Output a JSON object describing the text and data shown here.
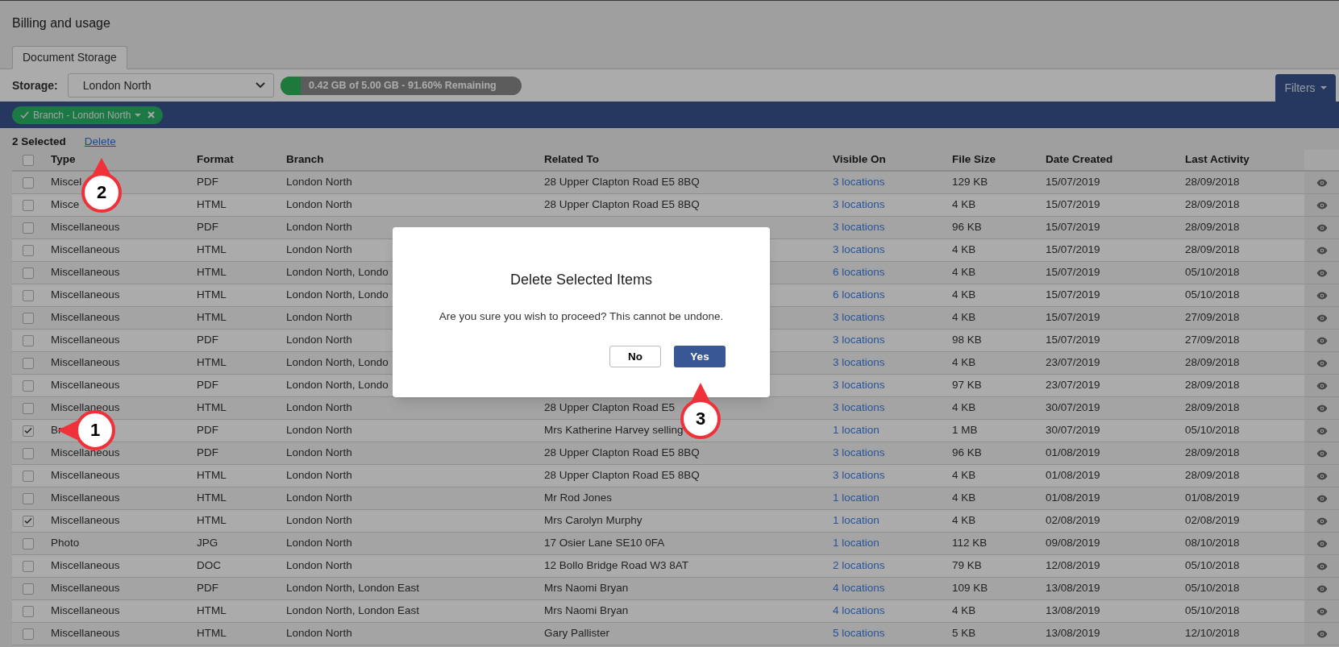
{
  "page": {
    "title": "Billing and usage"
  },
  "tabs": [
    {
      "label": "Document Storage",
      "selected": true
    }
  ],
  "storage": {
    "label": "Storage:",
    "value": "London North",
    "usage": {
      "level": 0.084,
      "text": "0.42 GB of 5.00 GB - 91.60% Remaining"
    }
  },
  "filters_button": {
    "label": "Filters"
  },
  "filter_chips": [
    {
      "label": "Branch - London North"
    }
  ],
  "selection": {
    "count": "2 Selected",
    "action": "Delete"
  },
  "table": {
    "select_all_checked": false,
    "columns": [
      "Type",
      "Format",
      "Branch",
      "Related To",
      "Visible On",
      "File Size",
      "Date Created",
      "Last Activity"
    ],
    "rows": [
      {
        "checked": false,
        "type": "Miscel",
        "format": "PDF",
        "branch": "London North",
        "related_to": "28 Upper Clapton Road E5 8BQ",
        "visible_on": "3 locations",
        "file_size": "129 KB",
        "date_created": "15/07/2019",
        "last_activity": "28/09/2018"
      },
      {
        "checked": false,
        "type": "Misce",
        "format": "HTML",
        "branch": "London North",
        "related_to": "28 Upper Clapton Road E5 8BQ",
        "visible_on": "3 locations",
        "file_size": "4 KB",
        "date_created": "15/07/2019",
        "last_activity": "28/09/2018"
      },
      {
        "checked": false,
        "type": "Miscellaneous",
        "format": "PDF",
        "branch": "London North",
        "visible_on": "3 locations",
        "file_size": "96 KB",
        "date_created": "15/07/2019",
        "last_activity": "28/09/2018"
      },
      {
        "checked": false,
        "type": "Miscellaneous",
        "format": "HTML",
        "branch": "London North",
        "visible_on": "3 locations",
        "file_size": "4 KB",
        "date_created": "15/07/2019",
        "last_activity": "28/09/2018"
      },
      {
        "checked": false,
        "type": "Miscellaneous",
        "format": "HTML",
        "branch": "London North, Londo",
        "visible_on": "6 locations",
        "file_size": "4 KB",
        "date_created": "15/07/2019",
        "last_activity": "05/10/2018"
      },
      {
        "checked": false,
        "type": "Miscellaneous",
        "format": "HTML",
        "branch": "London North, Londo",
        "visible_on": "6 locations",
        "file_size": "4 KB",
        "date_created": "15/07/2019",
        "last_activity": "05/10/2018"
      },
      {
        "checked": false,
        "type": "Miscellaneous",
        "format": "HTML",
        "branch": "London North",
        "visible_on": "3 locations",
        "file_size": "4 KB",
        "date_created": "15/07/2019",
        "last_activity": "27/09/2018"
      },
      {
        "checked": false,
        "type": "Miscellaneous",
        "format": "PDF",
        "branch": "London North",
        "visible_on": "3 locations",
        "file_size": "98 KB",
        "date_created": "15/07/2019",
        "last_activity": "27/09/2018"
      },
      {
        "checked": false,
        "type": "Miscellaneous",
        "format": "HTML",
        "branch": "London North, Londo",
        "visible_on": "3 locations",
        "file_size": "4 KB",
        "date_created": "23/07/2019",
        "last_activity": "28/09/2018"
      },
      {
        "checked": false,
        "type": "Miscellaneous",
        "format": "PDF",
        "branch": "London North, Londo",
        "visible_on": "3 locations",
        "file_size": "97 KB",
        "date_created": "23/07/2019",
        "last_activity": "28/09/2018"
      },
      {
        "checked": false,
        "type": "Miscellaneous",
        "format": "HTML",
        "branch": "London North",
        "related_to": "28 Upper Clapton Road E5",
        "visible_on": "3 locations",
        "file_size": "4 KB",
        "date_created": "30/07/2019",
        "last_activity": "28/09/2018"
      },
      {
        "checked": true,
        "type": "Br",
        "format": "PDF",
        "branch": "London North",
        "related_to": "Mrs Katherine Harvey selling",
        "visible_on": "1 location",
        "file_size": "1 MB",
        "date_created": "30/07/2019",
        "last_activity": "05/10/2018"
      },
      {
        "checked": false,
        "type": "Miscellaneous",
        "format": "PDF",
        "branch": "London North",
        "related_to": "28 Upper Clapton Road E5 8BQ",
        "visible_on": "3 locations",
        "file_size": "96 KB",
        "date_created": "01/08/2019",
        "last_activity": "28/09/2018"
      },
      {
        "checked": false,
        "type": "Miscellaneous",
        "format": "HTML",
        "branch": "London North",
        "related_to": "28 Upper Clapton Road E5 8BQ",
        "visible_on": "3 locations",
        "file_size": "4 KB",
        "date_created": "01/08/2019",
        "last_activity": "28/09/2018"
      },
      {
        "checked": false,
        "type": "Miscellaneous",
        "format": "HTML",
        "branch": "London North",
        "related_to": "Mr Rod Jones",
        "visible_on": "1 location",
        "file_size": "4 KB",
        "date_created": "01/08/2019",
        "last_activity": "01/08/2019"
      },
      {
        "checked": true,
        "type": "Miscellaneous",
        "format": "HTML",
        "branch": "London North",
        "related_to": "Mrs Carolyn Murphy",
        "visible_on": "1 location",
        "file_size": "4 KB",
        "date_created": "02/08/2019",
        "last_activity": "02/08/2019"
      },
      {
        "checked": false,
        "type": "Photo",
        "format": "JPG",
        "branch": "London North",
        "related_to": "17 Osier Lane SE10 0FA",
        "visible_on": "1 location",
        "file_size": "112 KB",
        "date_created": "09/08/2019",
        "last_activity": "08/10/2018"
      },
      {
        "checked": false,
        "type": "Miscellaneous",
        "format": "DOC",
        "branch": "London North",
        "related_to": "12 Bollo Bridge Road W3 8AT",
        "visible_on": "2 locations",
        "file_size": "79 KB",
        "date_created": "12/08/2019",
        "last_activity": "05/10/2018"
      },
      {
        "checked": false,
        "type": "Miscellaneous",
        "format": "PDF",
        "branch": "London North, London East",
        "related_to": "Mrs Naomi Bryan",
        "visible_on": "4 locations",
        "file_size": "109 KB",
        "date_created": "13/08/2019",
        "last_activity": "05/10/2018"
      },
      {
        "checked": false,
        "type": "Miscellaneous",
        "format": "HTML",
        "branch": "London North, London East",
        "related_to": "Mrs Naomi Bryan",
        "visible_on": "4 locations",
        "file_size": "4 KB",
        "date_created": "13/08/2019",
        "last_activity": "05/10/2018"
      },
      {
        "checked": false,
        "type": "Miscellaneous",
        "format": "HTML",
        "branch": "London North",
        "related_to": "Gary Pallister",
        "visible_on": "5 locations",
        "file_size": "5 KB",
        "date_created": "13/08/2019",
        "last_activity": "12/10/2018"
      }
    ]
  },
  "dialog": {
    "title": "Delete Selected Items",
    "message": "Are you sure you wish to proceed? This cannot be undone.",
    "buttons": [
      {
        "label": "No",
        "kind": "secondary"
      },
      {
        "label": "Yes",
        "kind": "primary"
      }
    ]
  },
  "step_markers": [
    {
      "label": "1"
    },
    {
      "label": "2"
    },
    {
      "label": "3"
    }
  ]
}
